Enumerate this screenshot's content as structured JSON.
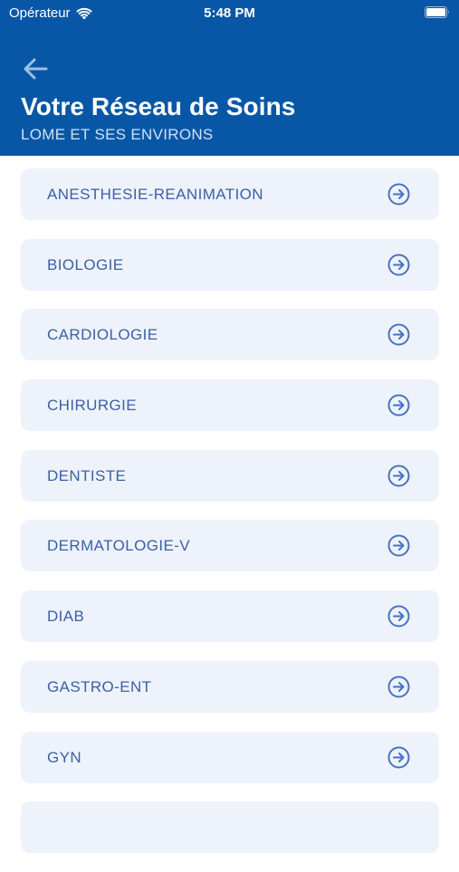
{
  "status_bar": {
    "carrier": "Opérateur",
    "time": "5:48 PM"
  },
  "header": {
    "title": "Votre Réseau de Soins",
    "subtitle": "LOME ET SES ENVIRONS",
    "background_color": "#0857a6"
  },
  "specialties": [
    {
      "label": "ANESTHESIE-REANIMATION"
    },
    {
      "label": "BIOLOGIE"
    },
    {
      "label": "CARDIOLOGIE"
    },
    {
      "label": "CHIRURGIE"
    },
    {
      "label": "DENTISTE"
    },
    {
      "label": "DERMATOLOGIE-V"
    },
    {
      "label": "DIAB"
    },
    {
      "label": "GASTRO-ENT"
    },
    {
      "label": "GYN"
    },
    {
      "label": ""
    }
  ],
  "icons": {
    "back": "arrow-left-icon",
    "item": "arrow-right-circle-icon"
  }
}
